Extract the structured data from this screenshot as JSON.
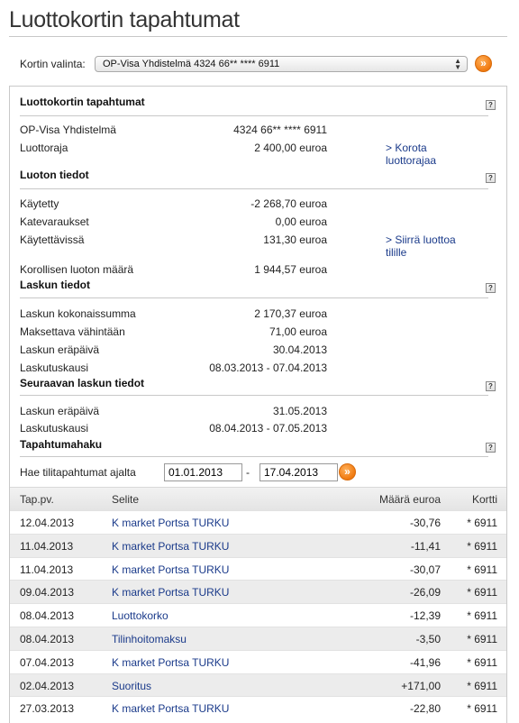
{
  "page": {
    "title": "Luottokortin tapahtumat"
  },
  "card_select": {
    "label": "Kortin valinta:",
    "value": "OP-Visa Yhdistelmä 4324 66** **** 6911"
  },
  "sections": {
    "card": {
      "title": "Luottokortin tapahtumat",
      "name_label": "OP-Visa Yhdistelmä",
      "number": "4324 66** **** 6911",
      "limit_label": "Luottoraja",
      "limit_value": "2 400,00 euroa",
      "raise_limit_link": "> Korota luottorajaa"
    },
    "credit": {
      "title": "Luoton tiedot",
      "used_label": "Käytetty",
      "used_value": "-2 268,70 euroa",
      "reservations_label": "Katevaraukset",
      "reservations_value": "0,00 euroa",
      "available_label": "Käytettävissä",
      "available_value": "131,30 euroa",
      "transfer_link": "> Siirrä luottoa tilille",
      "interest_label": "Korollisen luoton määrä",
      "interest_value": "1 944,57 euroa"
    },
    "invoice": {
      "title": "Laskun tiedot",
      "total_label": "Laskun kokonaissumma",
      "total_value": "2 170,37 euroa",
      "min_label": "Maksettava vähintään",
      "min_value": "71,00 euroa",
      "due_label": "Laskun eräpäivä",
      "due_value": "30.04.2013",
      "period_label": "Laskutuskausi",
      "period_value": "08.03.2013 - 07.04.2013"
    },
    "next_invoice": {
      "title": "Seuraavan laskun tiedot",
      "due_label": "Laskun eräpäivä",
      "due_value": "31.05.2013",
      "period_label": "Laskutuskausi",
      "period_value": "08.04.2013 - 07.05.2013"
    },
    "search": {
      "title": "Tapahtumahaku",
      "range_label": "Hae tilitapahtumat ajalta",
      "from": "01.01.2013",
      "dash": "-",
      "to": "17.04.2013"
    }
  },
  "help_glyph": "?",
  "go_glyph": "»",
  "table": {
    "headers": {
      "date": "Tap.pv.",
      "desc": "Selite",
      "amount": "Määrä euroa",
      "card": "Kortti"
    },
    "rows": [
      {
        "date": "12.04.2013",
        "desc": "K market Portsa TURKU",
        "amount": "-30,76",
        "card": "* 6911"
      },
      {
        "date": "11.04.2013",
        "desc": "K market Portsa TURKU",
        "amount": "-11,41",
        "card": "* 6911"
      },
      {
        "date": "11.04.2013",
        "desc": "K market Portsa TURKU",
        "amount": "-30,07",
        "card": "* 6911"
      },
      {
        "date": "09.04.2013",
        "desc": "K market Portsa TURKU",
        "amount": "-26,09",
        "card": "* 6911"
      },
      {
        "date": "08.04.2013",
        "desc": "Luottokorko",
        "amount": "-12,39",
        "card": "* 6911"
      },
      {
        "date": "08.04.2013",
        "desc": "Tilinhoitomaksu",
        "amount": "-3,50",
        "card": "* 6911"
      },
      {
        "date": "07.04.2013",
        "desc": "K market Portsa TURKU",
        "amount": "-41,96",
        "card": "* 6911"
      },
      {
        "date": "02.04.2013",
        "desc": "Suoritus",
        "amount": "+171,00",
        "card": "* 6911"
      },
      {
        "date": "27.03.2013",
        "desc": "K market Portsa TURKU",
        "amount": "-22,80",
        "card": "* 6911"
      }
    ]
  }
}
